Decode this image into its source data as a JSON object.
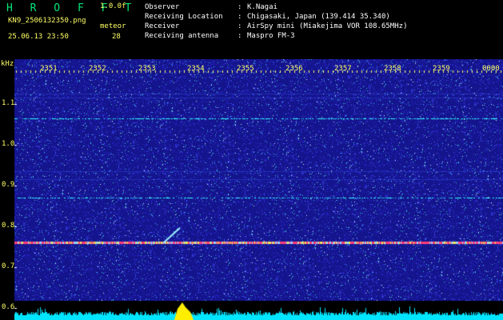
{
  "app": {
    "title": "H R O F F T",
    "version": "1.0.0f",
    "file_name": "KN9_2506132350.png",
    "timestamp": "25.06.13 23:50",
    "mode_label": "meteor",
    "mode_value": "28"
  },
  "meta": [
    {
      "label": "Observer",
      "value": "K.Nagai"
    },
    {
      "label": "Receiving Location",
      "value": "Chigasaki, Japan (139.414 35.340)"
    },
    {
      "label": "Receiver",
      "value": "AirSpy mini (Miakejima VOR 108.65MHz)"
    },
    {
      "label": "Receiving antenna",
      "value": "Maspro FM-3"
    }
  ],
  "colors": {
    "title": "#00e676",
    "text_yellow": "#ffff66",
    "text_white": "#ffffff",
    "axis_yellow": "#ffff66",
    "background_blue": "#14148c",
    "noise_line": "#30ffff",
    "carrier_line": "#ff3c78",
    "histogram": "#00e5ff",
    "peak": "#ffee00"
  },
  "spectrogram": {
    "unit": "kHz",
    "y_ticks": [
      "1.1",
      "1.0",
      "0.9",
      "0.8",
      "0.7",
      "0.6"
    ],
    "y_tick_values": [
      1.1,
      1.0,
      0.9,
      0.8,
      0.7,
      0.6
    ],
    "x_ticks": [
      "2351",
      "2352",
      "2353",
      "2354",
      "2355",
      "2356",
      "2357",
      "2358",
      "2359",
      "0000"
    ],
    "x_tick_minutes": [
      1,
      2,
      3,
      4,
      5,
      6,
      7,
      8,
      9,
      10
    ],
    "carrier_khz": 0.76,
    "noise_lines_khz": [
      1.065,
      0.87
    ],
    "meteor": {
      "start_minute": 3.6,
      "end_minute": 3.95,
      "khz_start": 0.77,
      "khz_end": 0.785
    }
  }
}
